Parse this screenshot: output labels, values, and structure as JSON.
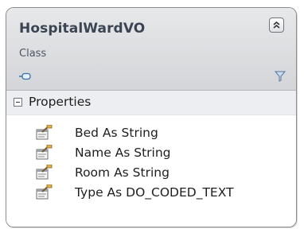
{
  "class_shape": {
    "name": "HospitalWardVO",
    "stereotype": "Class",
    "collapse_icon": "double-chevron-up-icon",
    "key_icon": "class-key-icon",
    "filter_icon": "filter-icon"
  },
  "compartment": {
    "title": "Properties",
    "expander_icon": "minus-box-icon",
    "members": [
      {
        "label": "Bed As String",
        "icon": "property-icon"
      },
      {
        "label": "Name As String",
        "icon": "property-icon"
      },
      {
        "label": "Room As String",
        "icon": "property-icon"
      },
      {
        "label": "Type As DO_CODED_TEXT",
        "icon": "property-icon"
      }
    ]
  },
  "colors": {
    "header_top": "#e7e8ea",
    "header_bottom": "#d4d5d8",
    "border": "#8c8c8c",
    "title_text": "#3a4452"
  }
}
